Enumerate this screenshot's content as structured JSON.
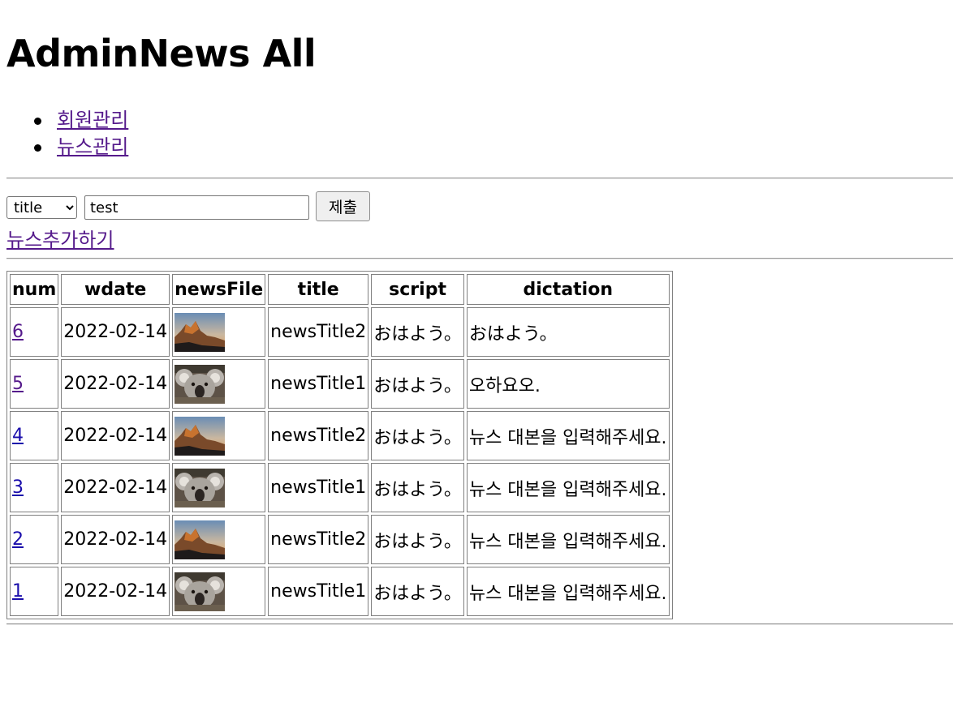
{
  "page": {
    "heading": "AdminNews All"
  },
  "nav": {
    "items": [
      {
        "label": "회원관리"
      },
      {
        "label": "뉴스관리"
      }
    ]
  },
  "search": {
    "field_options": [
      "title"
    ],
    "selected_field": "title",
    "query_value": "test",
    "submit_label": "제출"
  },
  "add_news_label": "뉴스추가하기",
  "table": {
    "headers": {
      "num": "num",
      "wdate": "wdate",
      "newsFile": "newsFile",
      "title": "title",
      "script": "script",
      "dictation": "dictation"
    },
    "rows": [
      {
        "num": "6",
        "wdate": "2022-02-14",
        "image": "desert-landscape-thumbnail",
        "title": "newsTitle2",
        "script": "おはよう。",
        "dictation": "おはよう。"
      },
      {
        "num": "5",
        "wdate": "2022-02-14",
        "image": "koala-thumbnail",
        "title": "newsTitle1",
        "script": "おはよう。",
        "dictation": "오하요오."
      },
      {
        "num": "4",
        "wdate": "2022-02-14",
        "image": "desert-landscape-thumbnail",
        "title": "newsTitle2",
        "script": "おはよう。",
        "dictation": "뉴스 대본을 입력해주세요."
      },
      {
        "num": "3",
        "wdate": "2022-02-14",
        "image": "koala-thumbnail",
        "title": "newsTitle1",
        "script": "おはよう。",
        "dictation": "뉴스 대본을 입력해주세요."
      },
      {
        "num": "2",
        "wdate": "2022-02-14",
        "image": "desert-landscape-thumbnail",
        "title": "newsTitle2",
        "script": "おはよう。",
        "dictation": "뉴스 대본을 입력해주세요."
      },
      {
        "num": "1",
        "wdate": "2022-02-14",
        "image": "koala-thumbnail",
        "title": "newsTitle1",
        "script": "おはよう。",
        "dictation": "뉴스 대본을 입력해주세요."
      }
    ]
  },
  "colors": {
    "visited_link": "#551a8b",
    "unvisited_link": "#1a0dab",
    "table_border": "#808080",
    "rule": "#9a9a9a"
  }
}
